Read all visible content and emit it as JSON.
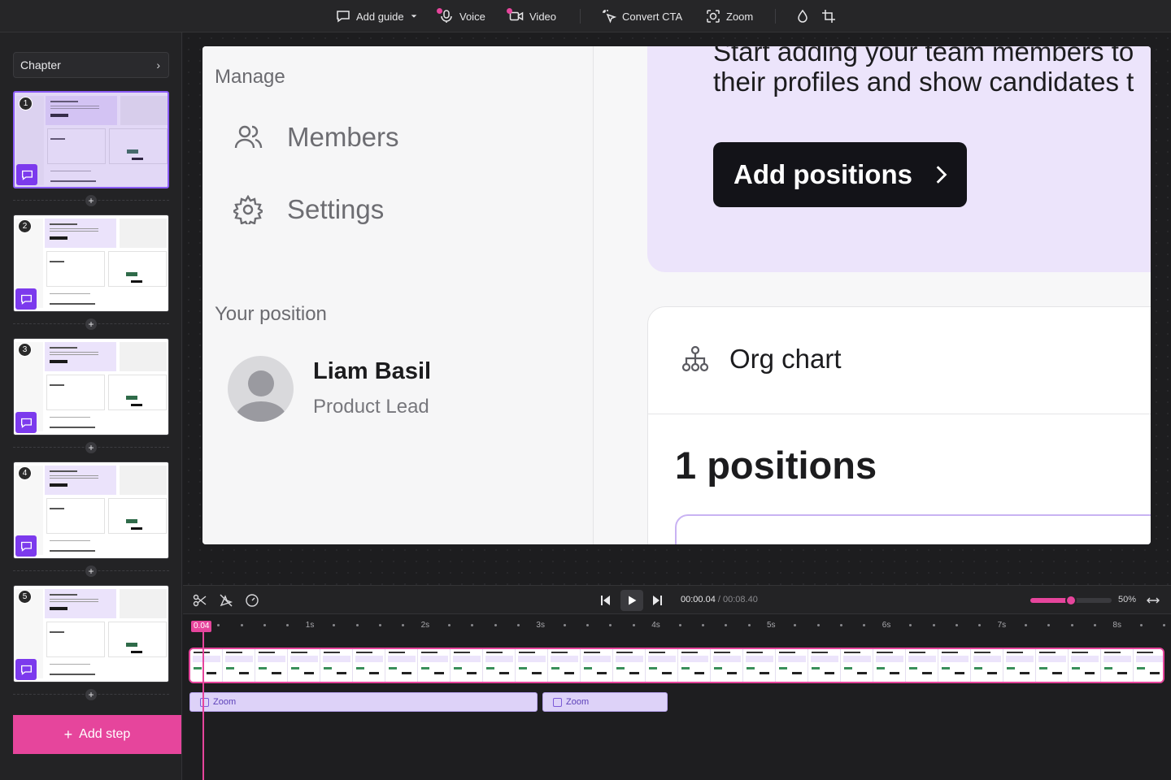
{
  "toolbar": {
    "add_guide": "Add guide",
    "voice": "Voice",
    "video": "Video",
    "convert_cta": "Convert CTA",
    "zoom": "Zoom"
  },
  "sidebar": {
    "chapter_label": "Chapter",
    "steps": [
      {
        "number": "1",
        "active": true
      },
      {
        "number": "2",
        "active": false
      },
      {
        "number": "3",
        "active": false
      },
      {
        "number": "4",
        "active": false
      },
      {
        "number": "5",
        "active": false
      }
    ],
    "add_step_label": "Add step"
  },
  "preview": {
    "manage_heading": "Manage",
    "nav_members": "Members",
    "nav_settings": "Settings",
    "your_position_heading": "Your position",
    "user_name": "Liam Basil",
    "user_role": "Product Lead",
    "hero_text_partial": "Start adding your team members to",
    "hero_text": "their profiles and show candidates t",
    "add_positions_label": "Add positions",
    "org_chart_label": "Org chart",
    "positions_count": "1 positions"
  },
  "timeline": {
    "current_time": "00:00.04",
    "total_time": " / 00:08.40",
    "zoom_percent": "50%",
    "zoom_level": 0.5,
    "playhead_label": "0.04",
    "ruler_labels": [
      "1s",
      "2s",
      "3s",
      "4s",
      "5s",
      "6s",
      "7s",
      "8s"
    ],
    "zoom_segments": [
      {
        "label": "Zoom"
      },
      {
        "label": "Zoom"
      }
    ]
  },
  "colors": {
    "accent_pink": "#e6459c",
    "accent_purple": "#7c3aed"
  }
}
